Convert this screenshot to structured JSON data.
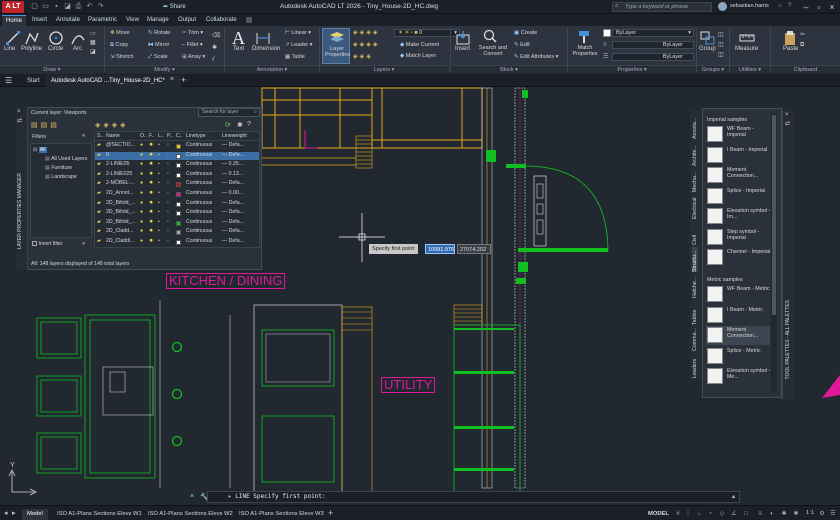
{
  "title_bar": {
    "app_badge": "A LT",
    "share_label": "Share",
    "document_title": "Autodesk AutoCAD LT 2026 - Tiny_House-2D_HC.dwg",
    "search_placeholder": "Type a keyword or phrase",
    "username": "sebastian.harris"
  },
  "ribbon_tabs": [
    "Home",
    "Insert",
    "Annotate",
    "Parametric",
    "View",
    "Manage",
    "Output",
    "Collaborate"
  ],
  "ribbon": {
    "draw": {
      "line": "Line",
      "polyline": "Polyline",
      "circle": "Circle",
      "arc": "Arc",
      "panel": "Draw"
    },
    "modify": {
      "move": "Move",
      "rotate": "Rotate",
      "trim": "Trim",
      "copy": "Copy",
      "mirror": "Mirror",
      "fillet": "Fillet",
      "stretch": "Stretch",
      "scale": "Scale",
      "array": "Array",
      "panel": "Modify"
    },
    "annotation": {
      "text": "Text",
      "dimension": "Dimension",
      "linear": "Linear",
      "leader": "Leader",
      "table": "Table",
      "panel": "Annotation"
    },
    "layers": {
      "layer_properties": "Layer Properties",
      "current_layer": "0",
      "make_current": "Make Current",
      "match_layer": "Match Layer",
      "panel": "Layers"
    },
    "block": {
      "insert": "Insert",
      "search_convert": "Search and Convert",
      "create": "Create",
      "edit": "Edit",
      "edit_attributes": "Edit Attributes",
      "panel": "Block"
    },
    "properties": {
      "match": "Match Properties",
      "color": "ByLayer",
      "linetype": "ByLayer",
      "lineweight": "ByLayer",
      "panel": "Properties"
    },
    "groups": {
      "group": "Group",
      "panel": "Groups"
    },
    "utilities": {
      "measure": "Measure",
      "panel": "Utilities"
    },
    "clipboard": {
      "paste": "Paste",
      "panel": "Clipboard"
    }
  },
  "file_tabs": [
    "Start",
    "Autodesk AutoCAD ...Tiny_House-2D_HC*"
  ],
  "layer_panel": {
    "side_title": "LAYER PROPERTIES MANAGER",
    "current_layer": "Current layer: Viewports",
    "search_placeholder": "Search for layer",
    "filters_label": "Filters",
    "filter_tree": [
      "All",
      "All Used Layers",
      "Furniture",
      "Landscape"
    ],
    "invert_filter": "Invert filter",
    "columns": [
      "S..",
      "Name",
      "O..",
      "F..",
      "L..",
      "P..",
      "C..",
      "Linetype",
      "Lineweight"
    ],
    "rows": [
      {
        "name": "@SECTIO...",
        "color": "#e8d000",
        "linetype": "Continuous",
        "lineweight": "Defa..."
      },
      {
        "name": "0",
        "color": "#ffffff",
        "linetype": "Continuous",
        "lineweight": "Defa..."
      },
      {
        "name": "2-LINIE05",
        "color": "#ffffff",
        "linetype": "Continuous",
        "lineweight": "0.25..."
      },
      {
        "name": "2-LINIE025",
        "color": "#ffffff",
        "linetype": "Continuous",
        "lineweight": "0.13..."
      },
      {
        "name": "2-MÖBEL-...",
        "color": "#d01010",
        "linetype": "Continuous",
        "lineweight": "Defa..."
      },
      {
        "name": "2D_Annot...",
        "color": "#e0189a",
        "linetype": "Continuous",
        "lineweight": "0.00..."
      },
      {
        "name": "2D_Bifold_...",
        "color": "#ffffff",
        "linetype": "Continuous",
        "lineweight": "Defa..."
      },
      {
        "name": "2D_Bifold_...",
        "color": "#ffffff",
        "linetype": "Continuous",
        "lineweight": "Defa..."
      },
      {
        "name": "2D_Bifold_...",
        "color": "#10c020",
        "linetype": "Continuous",
        "lineweight": "Defa..."
      },
      {
        "name": "2D_Cladd...",
        "color": "#aaaaaa",
        "linetype": "Continuous",
        "lineweight": "Defa..."
      },
      {
        "name": "2D_Claddi...",
        "color": "#ffffff",
        "linetype": "Continuous",
        "lineweight": "Defa..."
      }
    ],
    "footer": "All: 148 layers displayed of 148 total layers"
  },
  "tool_palette": {
    "side_title": "TOOL PALETTES - ALL PALETTES",
    "imperial_header": "Imperial samples",
    "metric_header": "Metric samples",
    "imperial_items": [
      "WF Beam - Imperial",
      "I Beam - Imperial",
      "Moment Connection...",
      "Splice - Imperial",
      "Elevation symbol - Im...",
      "Step symbol - Imperial",
      "Channel - Imperial"
    ],
    "metric_items": [
      "WF Beam - Metric",
      "I Beam - Metric",
      "Moment Connection...",
      "Splice - Metric",
      "Elevation symbol - Me..."
    ],
    "vertical_tabs": [
      "Annota...",
      "Archite...",
      "Mecha...",
      "Electrical",
      "Civil",
      "Structu...",
      "Hatche...",
      "Tables",
      "Comma...",
      "Leaders"
    ]
  },
  "drawing": {
    "room_kitchen": "KITCHEN / DINING",
    "room_utility": "UTILITY",
    "tooltip_label": "Specify first point:",
    "coord_x": "10991.976",
    "coord_y": "27074.202"
  },
  "command_line": {
    "text": "LINE Specify first point:"
  },
  "status_bar": {
    "layout_tabs": [
      "Model",
      "ISO A1-Plans Sections Elevs W1",
      "ISO A1-Plans Sections Elevs W2",
      "ISO A1-Plans Sections Elevs W3"
    ],
    "model_label": "MODEL",
    "scale": "1:1"
  }
}
